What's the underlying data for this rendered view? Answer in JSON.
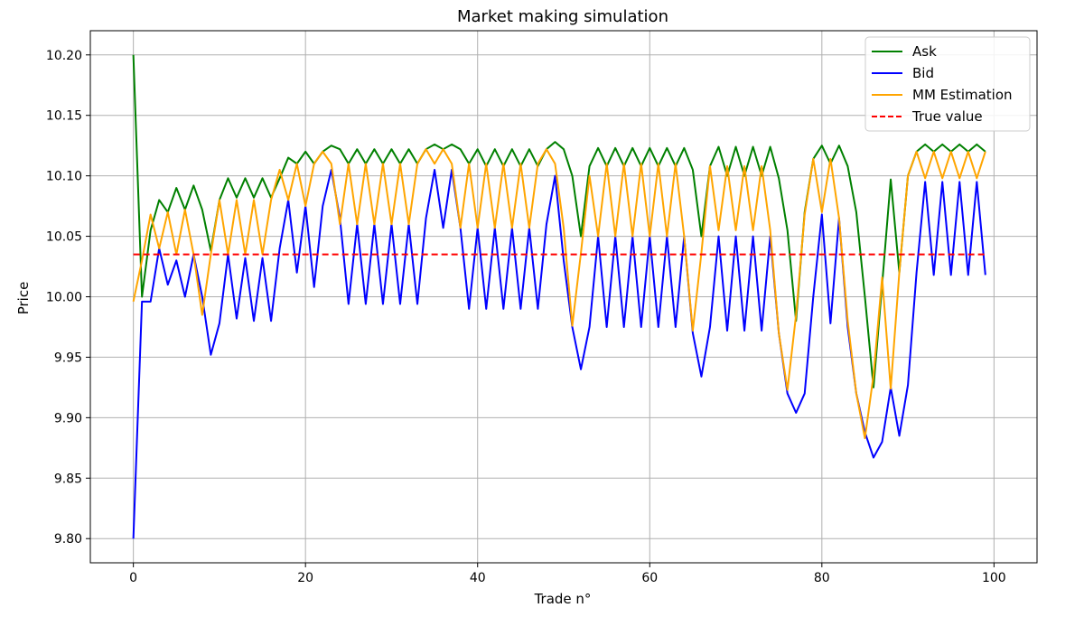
{
  "chart_data": {
    "type": "line",
    "title": "Market making simulation",
    "xlabel": "Trade n°",
    "ylabel": "Price",
    "xlim": [
      -5,
      105
    ],
    "ylim": [
      9.78,
      10.22
    ],
    "xticks": [
      0,
      20,
      40,
      60,
      80,
      100
    ],
    "yticks": [
      9.8,
      9.85,
      9.9,
      9.95,
      10.0,
      10.05,
      10.1,
      10.15,
      10.2
    ],
    "grid": true,
    "legend_position": "top-right",
    "true_value": 10.035,
    "series": [
      {
        "name": "Ask",
        "color": "#008000",
        "dash": "solid",
        "values": [
          10.2,
          10.0,
          10.055,
          10.08,
          10.07,
          10.09,
          10.072,
          10.092,
          10.072,
          10.038,
          10.08,
          10.098,
          10.082,
          10.098,
          10.082,
          10.098,
          10.082,
          10.098,
          10.115,
          10.11,
          10.12,
          10.11,
          10.12,
          10.125,
          10.122,
          10.11,
          10.122,
          10.11,
          10.122,
          10.11,
          10.122,
          10.11,
          10.122,
          10.11,
          10.122,
          10.126,
          10.122,
          10.126,
          10.122,
          10.11,
          10.122,
          10.108,
          10.122,
          10.108,
          10.122,
          10.108,
          10.122,
          10.108,
          10.122,
          10.128,
          10.122,
          10.1,
          10.05,
          10.108,
          10.123,
          10.108,
          10.123,
          10.108,
          10.123,
          10.108,
          10.123,
          10.108,
          10.123,
          10.108,
          10.123,
          10.105,
          10.05,
          10.108,
          10.124,
          10.1,
          10.124,
          10.1,
          10.124,
          10.1,
          10.124,
          10.098,
          10.055,
          9.98,
          10.07,
          10.114,
          10.125,
          10.11,
          10.125,
          10.108,
          10.07,
          10.0,
          9.925,
          10.01,
          10.097,
          10.02,
          10.1,
          10.12,
          10.126,
          10.12,
          10.126,
          10.12,
          10.126,
          10.12,
          10.126,
          10.12
        ]
      },
      {
        "name": "Bid",
        "color": "#0000ff",
        "dash": "solid",
        "values": [
          9.8,
          9.996,
          9.996,
          10.04,
          10.01,
          10.03,
          10.0,
          10.035,
          10.0,
          9.952,
          9.978,
          10.035,
          9.982,
          10.032,
          9.98,
          10.032,
          9.98,
          10.04,
          10.08,
          10.02,
          10.075,
          10.008,
          10.075,
          10.105,
          10.065,
          9.994,
          10.06,
          9.994,
          10.06,
          9.994,
          10.06,
          9.994,
          10.06,
          9.994,
          10.065,
          10.105,
          10.057,
          10.105,
          10.057,
          9.99,
          10.057,
          9.99,
          10.057,
          9.99,
          10.057,
          9.99,
          10.057,
          9.99,
          10.06,
          10.1,
          10.03,
          9.975,
          9.94,
          9.975,
          10.05,
          9.975,
          10.05,
          9.975,
          10.05,
          9.975,
          10.05,
          9.975,
          10.05,
          9.975,
          10.05,
          9.97,
          9.934,
          9.975,
          10.05,
          9.972,
          10.05,
          9.972,
          10.05,
          9.972,
          10.05,
          9.97,
          9.92,
          9.904,
          9.92,
          10.0,
          10.068,
          9.978,
          10.065,
          9.975,
          9.92,
          9.888,
          9.867,
          9.88,
          9.925,
          9.885,
          9.927,
          10.02,
          10.095,
          10.018,
          10.095,
          10.018,
          10.095,
          10.018,
          10.095,
          10.018
        ]
      },
      {
        "name": "MM Estimation",
        "color": "#ffa500",
        "dash": "solid",
        "values": [
          9.996,
          10.03,
          10.068,
          10.04,
          10.07,
          10.035,
          10.072,
          10.035,
          9.985,
          10.035,
          10.08,
          10.035,
          10.08,
          10.035,
          10.08,
          10.035,
          10.08,
          10.105,
          10.08,
          10.11,
          10.075,
          10.11,
          10.12,
          10.11,
          10.06,
          10.11,
          10.06,
          10.11,
          10.06,
          10.11,
          10.06,
          10.11,
          10.06,
          10.11,
          10.122,
          10.11,
          10.122,
          10.11,
          10.057,
          10.11,
          10.057,
          10.11,
          10.057,
          10.11,
          10.057,
          10.11,
          10.057,
          10.11,
          10.122,
          10.11,
          10.057,
          9.976,
          10.036,
          10.1,
          10.05,
          10.11,
          10.05,
          10.11,
          10.05,
          10.11,
          10.05,
          10.11,
          10.05,
          10.11,
          10.05,
          9.972,
          10.036,
          10.108,
          10.055,
          10.108,
          10.055,
          10.108,
          10.055,
          10.108,
          10.055,
          9.97,
          9.923,
          9.985,
          10.068,
          10.114,
          10.07,
          10.114,
          10.065,
          9.98,
          9.92,
          9.883,
          9.935,
          10.016,
          9.924,
          10.02,
          10.1,
          10.12,
          10.098,
          10.12,
          10.098,
          10.12,
          10.098,
          10.12,
          10.098,
          10.12
        ]
      }
    ],
    "reference_line": {
      "name": "True value",
      "value": 10.035,
      "color": "#ff0000",
      "dash": "dashed"
    },
    "legend": [
      {
        "label": "Ask",
        "color": "#008000",
        "dash": "solid"
      },
      {
        "label": "Bid",
        "color": "#0000ff",
        "dash": "solid"
      },
      {
        "label": "MM Estimation",
        "color": "#ffa500",
        "dash": "solid"
      },
      {
        "label": "True value",
        "color": "#ff0000",
        "dash": "dashed"
      }
    ]
  }
}
